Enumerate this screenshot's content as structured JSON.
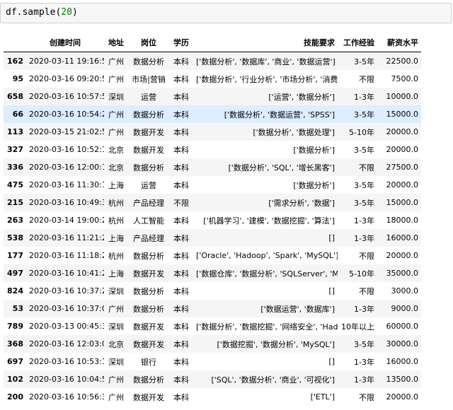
{
  "input_cell": {
    "code_prefix": "df.sample(",
    "code_arg": "20",
    "code_suffix": ")"
  },
  "columns": [
    "创建时间",
    "地址",
    "岗位",
    "学历",
    "技能要求",
    "工作经验",
    "薪资水平"
  ],
  "rows": [
    {
      "idx": "162",
      "time": "2020-03-11 19:16:54",
      "city": "广州",
      "job": "数据分析",
      "edu": "本科",
      "skills": "['数据分析', '数据库', '商业', '数据运营']",
      "exp": "3-5年",
      "salary": "22500.0"
    },
    {
      "idx": "95",
      "time": "2020-03-16 09:20:52",
      "city": "广州",
      "job": "市场|营销",
      "edu": "本科",
      "skills": "['数据分析', '行业分析', '市场分析', '消费者分析']",
      "exp": "不限",
      "salary": "7500.0"
    },
    {
      "idx": "658",
      "time": "2020-03-16 10:57:50",
      "city": "深圳",
      "job": "运营",
      "edu": "本科",
      "skills": "['运营', '数据分析']",
      "exp": "1-3年",
      "salary": "10000.0"
    },
    {
      "idx": "66",
      "time": "2020-03-16 10:54:23",
      "city": "广州",
      "job": "数据分析",
      "edu": "本科",
      "skills": "['数据分析', '数据运营', 'SPSS']",
      "exp": "3-5年",
      "salary": "15000.0"
    },
    {
      "idx": "113",
      "time": "2020-03-15 21:02:55",
      "city": "广州",
      "job": "数据开发",
      "edu": "本科",
      "skills": "['数据分析', '数据处理']",
      "exp": "5-10年",
      "salary": "20000.0"
    },
    {
      "idx": "327",
      "time": "2020-03-16 10:52:13",
      "city": "北京",
      "job": "数据开发",
      "edu": "本科",
      "skills": "['数据分析']",
      "exp": "3-5年",
      "salary": "20000.0"
    },
    {
      "idx": "336",
      "time": "2020-03-16 12:00:18",
      "city": "北京",
      "job": "数据分析",
      "edu": "本科",
      "skills": "['数据分析', 'SQL', '增长黑客']",
      "exp": "不限",
      "salary": "27500.0"
    },
    {
      "idx": "475",
      "time": "2020-03-16 11:30:14",
      "city": "上海",
      "job": "运营",
      "edu": "本科",
      "skills": "['数据分析']",
      "exp": "3-5年",
      "salary": "20000.0"
    },
    {
      "idx": "215",
      "time": "2020-03-16 10:49:33",
      "city": "杭州",
      "job": "产品经理",
      "edu": "不限",
      "skills": "['需求分析', '数据']",
      "exp": "3-5年",
      "salary": "15000.0"
    },
    {
      "idx": "263",
      "time": "2020-03-14 19:00:24",
      "city": "杭州",
      "job": "人工智能",
      "edu": "本科",
      "skills": "['机器学习', '建模', '数据挖掘', '算法']",
      "exp": "1-3年",
      "salary": "18000.0"
    },
    {
      "idx": "538",
      "time": "2020-03-16 11:21:24",
      "city": "上海",
      "job": "产品经理",
      "edu": "本科",
      "skills": "[]",
      "exp": "1-3年",
      "salary": "16000.0"
    },
    {
      "idx": "177",
      "time": "2020-03-16 11:18:23",
      "city": "杭州",
      "job": "数据分析",
      "edu": "本科",
      "skills": "['Oracle', 'Hadoop', 'Spark', 'MySQL']",
      "exp": "不限",
      "salary": "20000.0"
    },
    {
      "idx": "497",
      "time": "2020-03-16 10:41:20",
      "city": "上海",
      "job": "数据开发",
      "edu": "本科",
      "skills": "['数据仓库', '数据分析', 'SQLServer', 'MySQL']",
      "exp": "5-10年",
      "salary": "35000.0"
    },
    {
      "idx": "824",
      "time": "2020-03-16 10:37:24",
      "city": "深圳",
      "job": "数据分析",
      "edu": "本科",
      "skills": "[]",
      "exp": "不限",
      "salary": "3000.0"
    },
    {
      "idx": "53",
      "time": "2020-03-16 10:37:03",
      "city": "广州",
      "job": "数据分析",
      "edu": "本科",
      "skills": "['数据运营', '数据库']",
      "exp": "1-3年",
      "salary": "9000.0"
    },
    {
      "idx": "789",
      "time": "2020-03-13 00:45:34",
      "city": "深圳",
      "job": "数据开发",
      "edu": "本科",
      "skills": "['数据分析', '数据挖掘', '网络安全', 'Hadoop']",
      "exp": "10年以上",
      "salary": "60000.0"
    },
    {
      "idx": "368",
      "time": "2020-03-16 12:03:05",
      "city": "北京",
      "job": "数据开发",
      "edu": "本科",
      "skills": "['数据挖掘', '数据分析', 'MySQL']",
      "exp": "3-5年",
      "salary": "30000.0"
    },
    {
      "idx": "697",
      "time": "2020-03-16 10:53:17",
      "city": "深圳",
      "job": "银行",
      "edu": "本科",
      "skills": "[]",
      "exp": "1-3年",
      "salary": "16000.0"
    },
    {
      "idx": "102",
      "time": "2020-03-16 10:04:59",
      "city": "广州",
      "job": "数据分析",
      "edu": "本科",
      "skills": "['SQL', '数据分析', '商业', '可视化']",
      "exp": "1-3年",
      "salary": "13500.0"
    },
    {
      "idx": "200",
      "time": "2020-03-16 10:56:30",
      "city": "广州",
      "job": "数据开发",
      "edu": "本科",
      "skills": "['ETL']",
      "exp": "不限",
      "salary": "20000.0"
    }
  ],
  "highlight_row_index": 3
}
